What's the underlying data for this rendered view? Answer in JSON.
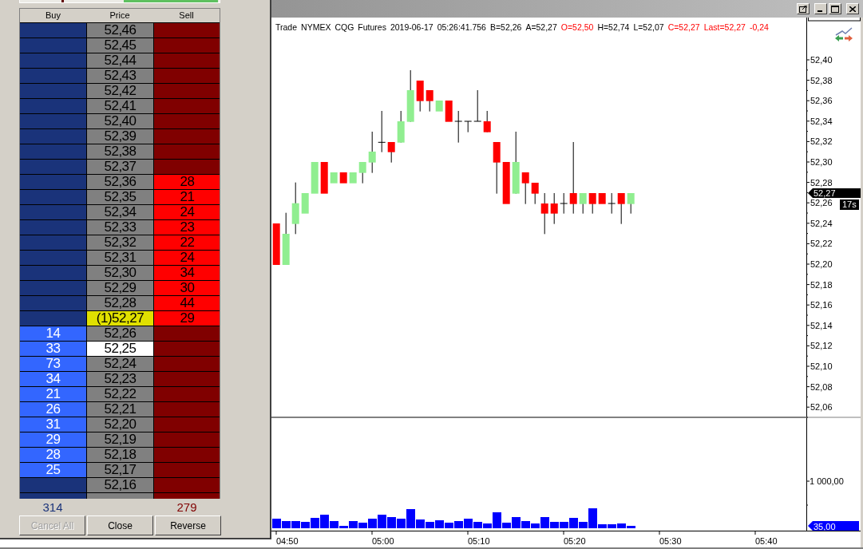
{
  "dom_ladder": {
    "columns": [
      "Buy",
      "Price",
      "Sell"
    ],
    "rows": [
      {
        "price": "52,46",
        "last": false,
        "current": false
      },
      {
        "price": "52,45",
        "last": false,
        "current": false
      },
      {
        "price": "52,44",
        "last": false,
        "current": false
      },
      {
        "price": "52,43",
        "last": false,
        "current": false
      },
      {
        "price": "52,42",
        "last": false,
        "current": false
      },
      {
        "price": "52,41",
        "last": false,
        "current": false
      },
      {
        "price": "52,40",
        "last": false,
        "current": false
      },
      {
        "price": "52,39",
        "last": false,
        "current": false
      },
      {
        "price": "52,38",
        "last": false,
        "current": false
      },
      {
        "price": "52,37",
        "last": false,
        "current": false
      },
      {
        "price": "52,36",
        "last": false,
        "current": false,
        "sell": "28"
      },
      {
        "price": "52,35",
        "last": false,
        "current": false,
        "sell": "21"
      },
      {
        "price": "52,34",
        "last": false,
        "current": false,
        "sell": "24"
      },
      {
        "price": "52,33",
        "last": false,
        "current": false,
        "sell": "23"
      },
      {
        "price": "52,32",
        "last": false,
        "current": false,
        "sell": "22"
      },
      {
        "price": "52,31",
        "last": false,
        "current": false,
        "sell": "24"
      },
      {
        "price": "52,30",
        "last": false,
        "current": false,
        "sell": "34"
      },
      {
        "price": "52,29",
        "last": false,
        "current": false,
        "sell": "30"
      },
      {
        "price": "52,28",
        "last": false,
        "current": false,
        "sell": "44"
      },
      {
        "price": "(1)52,27",
        "last": true,
        "current": false,
        "sell": "29"
      },
      {
        "price": "52,26",
        "last": false,
        "current": false,
        "buy": "14"
      },
      {
        "price": "52,25",
        "last": false,
        "current": true,
        "buy": "33"
      },
      {
        "price": "52,24",
        "last": false,
        "current": false,
        "buy": "73"
      },
      {
        "price": "52,23",
        "last": false,
        "current": false,
        "buy": "34"
      },
      {
        "price": "52,22",
        "last": false,
        "current": false,
        "buy": "21"
      },
      {
        "price": "52,21",
        "last": false,
        "current": false,
        "buy": "26"
      },
      {
        "price": "52,20",
        "last": false,
        "current": false,
        "buy": "31"
      },
      {
        "price": "52,19",
        "last": false,
        "current": false,
        "buy": "29"
      },
      {
        "price": "52,18",
        "last": false,
        "current": false,
        "buy": "28"
      },
      {
        "price": "52,17",
        "last": false,
        "current": false,
        "buy": "25"
      },
      {
        "price": "52,16",
        "last": false,
        "current": false
      }
    ],
    "totals": {
      "buy": "314",
      "sell": "279"
    },
    "buttons": [
      {
        "label": "Cancel All",
        "disabled": true
      },
      {
        "label": "Close",
        "disabled": false
      },
      {
        "label": "Reverse",
        "disabled": false
      }
    ]
  },
  "chart": {
    "info": [
      {
        "text": "Trade",
        "highlight": false
      },
      {
        "text": "NYMEX",
        "highlight": false
      },
      {
        "text": "CQG",
        "highlight": false
      },
      {
        "text": "Futures",
        "highlight": false
      },
      {
        "text": "2019-06-17",
        "highlight": false
      },
      {
        "text": "05:26:41.756",
        "highlight": false
      },
      {
        "text": "B=52,26",
        "highlight": false
      },
      {
        "text": "A=52,27",
        "highlight": false
      },
      {
        "text": "O=52,50",
        "highlight": true
      },
      {
        "text": "H=52,74",
        "highlight": false
      },
      {
        "text": "L=52,07",
        "highlight": false
      },
      {
        "text": "C=52,27",
        "highlight": true
      },
      {
        "text": "Last=52,27",
        "highlight": true
      },
      {
        "text": "-0,24",
        "highlight": true
      }
    ],
    "price_axis": {
      "labels": [
        "52,40",
        "52,38",
        "52,36",
        "52,34",
        "52,32",
        "52,30",
        "52,28",
        "52,26",
        "52,24",
        "52,22",
        "52,20",
        "52,18",
        "52,16",
        "52,14",
        "52,12",
        "52,10",
        "52,08",
        "52,06"
      ],
      "last_price_tag": "52,27",
      "timer_tag": "17s"
    },
    "volume_axis": {
      "label": "1 000,00",
      "last_volume_tag": "35,00"
    },
    "time_axis": [
      "04:50",
      "05:00",
      "05:10",
      "05:20",
      "05:30",
      "05:40"
    ]
  }
}
